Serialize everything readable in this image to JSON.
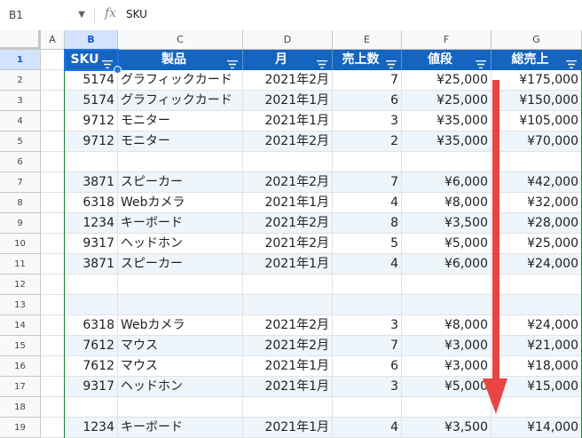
{
  "formula_bar": {
    "name_box": "B1",
    "fx_label": "fx",
    "content": "SKU"
  },
  "columns": [
    "A",
    "B",
    "C",
    "D",
    "E",
    "F",
    "G"
  ],
  "selected_column": "B",
  "header_row": {
    "row_number": "1",
    "labels": [
      "SKU",
      "製品",
      "月",
      "売上数",
      "値段",
      "総売上"
    ]
  },
  "rows": [
    {
      "n": "2",
      "sku": "5174",
      "product": "グラフィックカード",
      "month": "2021年2月",
      "qty": "7",
      "price": "¥25,000",
      "total": "¥175,000"
    },
    {
      "n": "3",
      "sku": "5174",
      "product": "グラフィックカード",
      "month": "2021年1月",
      "qty": "6",
      "price": "¥25,000",
      "total": "¥150,000"
    },
    {
      "n": "4",
      "sku": "9712",
      "product": "モニター",
      "month": "2021年1月",
      "qty": "3",
      "price": "¥35,000",
      "total": "¥105,000"
    },
    {
      "n": "5",
      "sku": "9712",
      "product": "モニター",
      "month": "2021年2月",
      "qty": "2",
      "price": "¥35,000",
      "total": "¥70,000"
    },
    {
      "n": "6",
      "sku": "",
      "product": "",
      "month": "",
      "qty": "",
      "price": "",
      "total": ""
    },
    {
      "n": "7",
      "sku": "3871",
      "product": "スピーカー",
      "month": "2021年2月",
      "qty": "7",
      "price": "¥6,000",
      "total": "¥42,000"
    },
    {
      "n": "8",
      "sku": "6318",
      "product": "Webカメラ",
      "month": "2021年1月",
      "qty": "4",
      "price": "¥8,000",
      "total": "¥32,000"
    },
    {
      "n": "9",
      "sku": "1234",
      "product": "キーボード",
      "month": "2021年2月",
      "qty": "8",
      "price": "¥3,500",
      "total": "¥28,000"
    },
    {
      "n": "10",
      "sku": "9317",
      "product": "ヘッドホン",
      "month": "2021年2月",
      "qty": "5",
      "price": "¥5,000",
      "total": "¥25,000"
    },
    {
      "n": "11",
      "sku": "3871",
      "product": "スピーカー",
      "month": "2021年1月",
      "qty": "4",
      "price": "¥6,000",
      "total": "¥24,000"
    },
    {
      "n": "12",
      "sku": "",
      "product": "",
      "month": "",
      "qty": "",
      "price": "",
      "total": ""
    },
    {
      "n": "13",
      "sku": "",
      "product": "",
      "month": "",
      "qty": "",
      "price": "",
      "total": ""
    },
    {
      "n": "14",
      "sku": "6318",
      "product": "Webカメラ",
      "month": "2021年2月",
      "qty": "3",
      "price": "¥8,000",
      "total": "¥24,000"
    },
    {
      "n": "15",
      "sku": "7612",
      "product": "マウス",
      "month": "2021年2月",
      "qty": "7",
      "price": "¥3,000",
      "total": "¥21,000"
    },
    {
      "n": "16",
      "sku": "7612",
      "product": "マウス",
      "month": "2021年1月",
      "qty": "6",
      "price": "¥3,000",
      "total": "¥18,000"
    },
    {
      "n": "17",
      "sku": "9317",
      "product": "ヘッドホン",
      "month": "2021年1月",
      "qty": "3",
      "price": "¥5,000",
      "total": "¥15,000"
    },
    {
      "n": "18",
      "sku": "",
      "product": "",
      "month": "",
      "qty": "",
      "price": "",
      "total": ""
    },
    {
      "n": "19",
      "sku": "1234",
      "product": "キーボード",
      "month": "2021年1月",
      "qty": "4",
      "price": "¥3,500",
      "total": "¥14,000"
    }
  ],
  "colors": {
    "header_bg": "#1565c0",
    "band_light": "#eef5fb",
    "arrow": "#e84444",
    "selection": "#1a73e8"
  },
  "annotation": {
    "arrow": "red-down-arrow"
  }
}
